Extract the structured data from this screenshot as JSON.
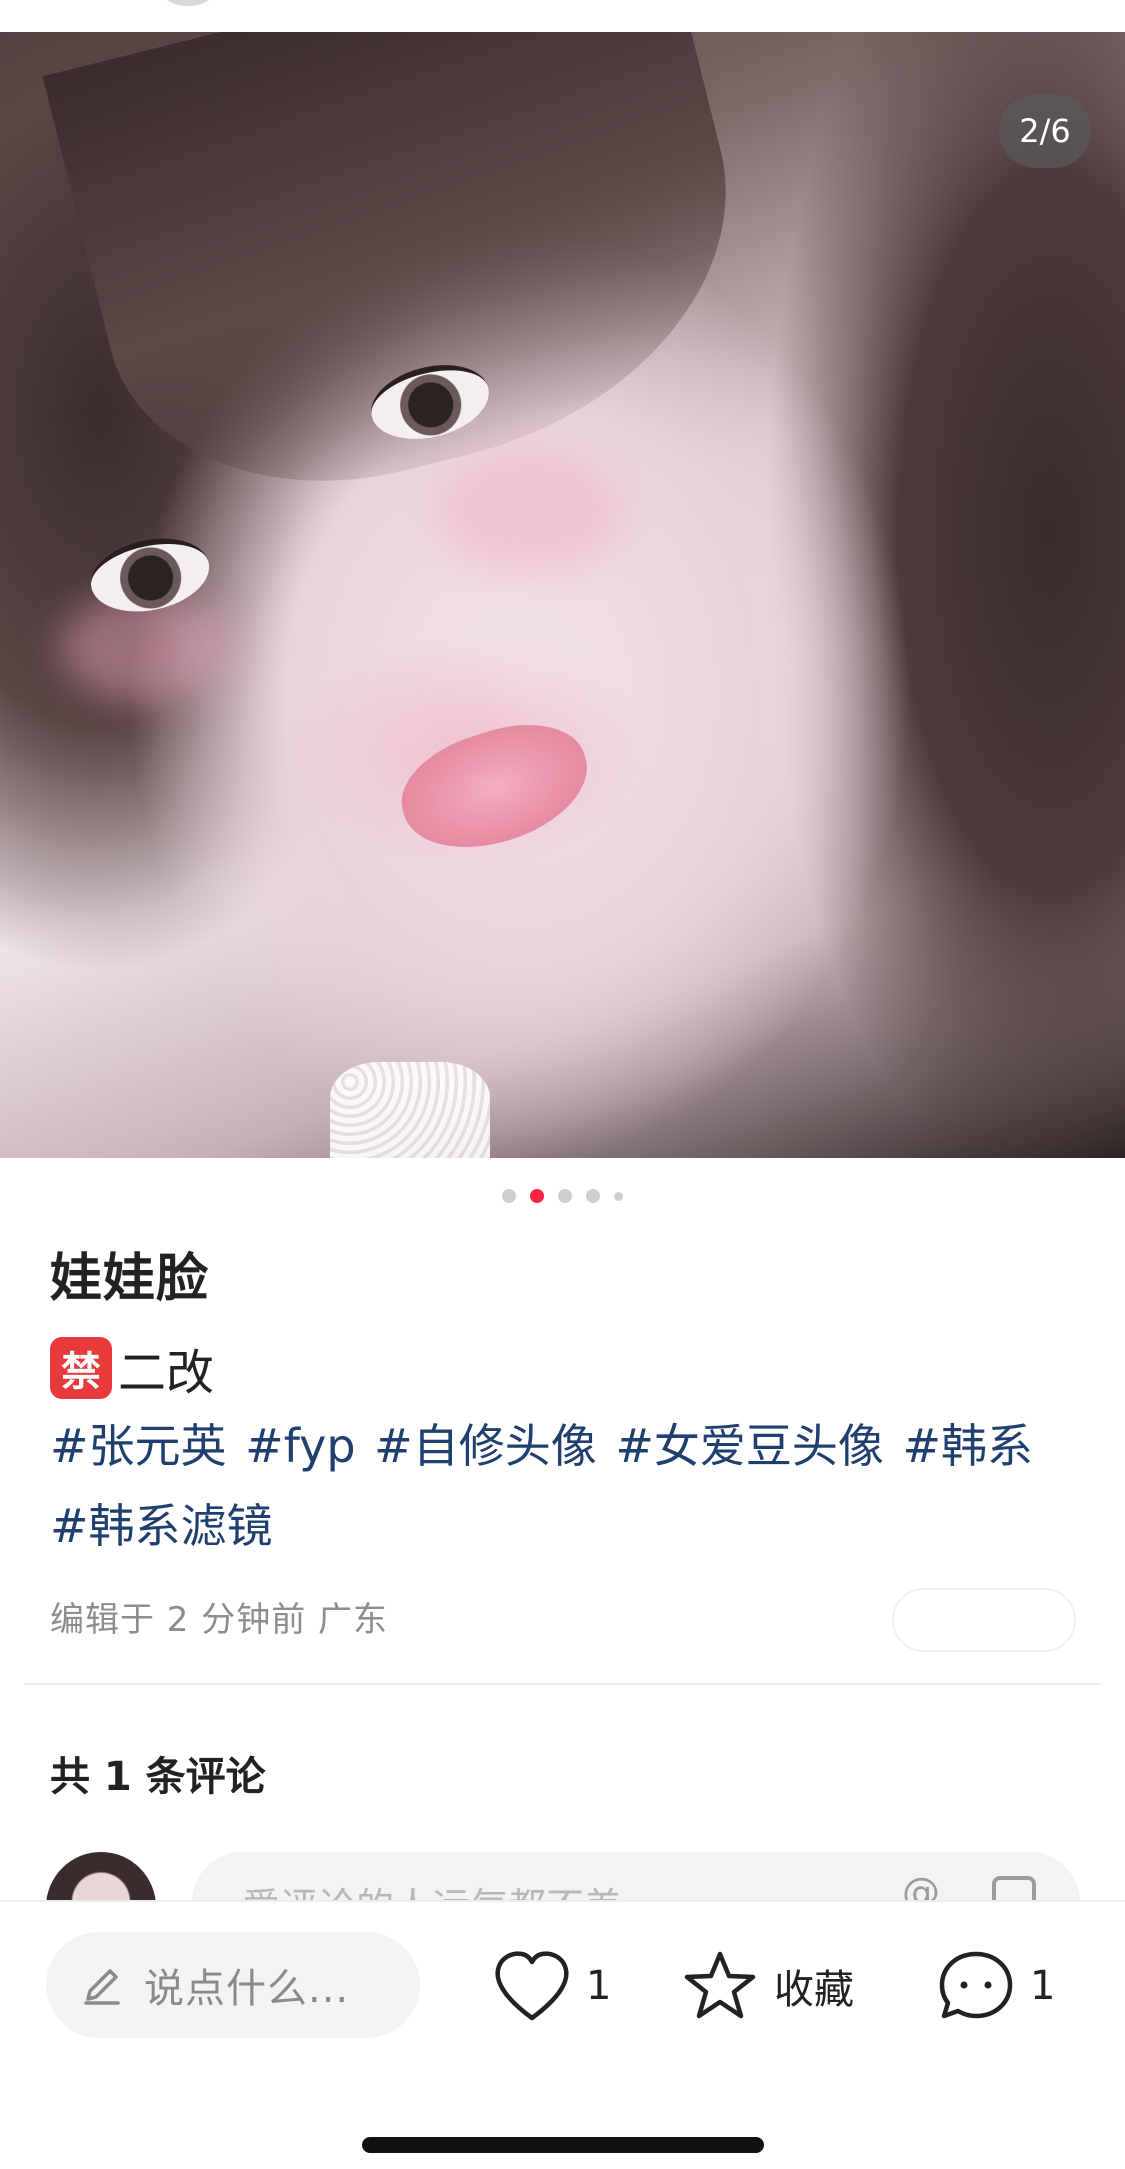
{
  "viewer": {
    "counter": "2/6",
    "dot_count": 5,
    "active_dot": 1
  },
  "post": {
    "title": "娃娃脸",
    "ban_badge": "禁",
    "ban_text": "二改",
    "tags": [
      "#张元英",
      "#fyp",
      "#自修头像",
      "#女爱豆头像",
      "#韩系",
      "#韩系滤镜"
    ],
    "meta": "编辑于 2 分钟前 广东"
  },
  "comments": {
    "count_label": "共 1 条评论",
    "input_placeholder": "爱评论的人运气都不差",
    "at_symbol": "@"
  },
  "bottom_bar": {
    "say_placeholder": "说点什么...",
    "like_count": "1",
    "favorite_label": "收藏",
    "comment_count": "1"
  },
  "colors": {
    "accent": "#ff2442",
    "tag": "#1f3f6e",
    "ban_badge": "#e8393b"
  }
}
